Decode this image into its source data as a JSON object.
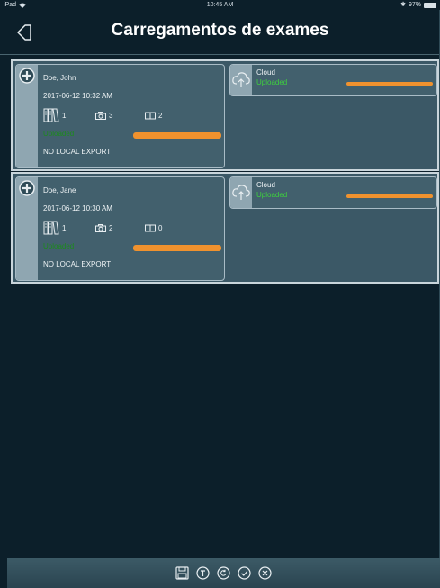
{
  "status_bar": {
    "device": "iPad",
    "time": "10:45 AM",
    "battery": "97%"
  },
  "header": {
    "title": "Carregamentos de exames",
    "back_icon": "back-arrow-icon"
  },
  "exams": [
    {
      "name": "Doe, John",
      "date": "2017-06-12 10:32 AM",
      "series_count": "1",
      "photo_count": "3",
      "report_count": "2",
      "status": "Uploaded",
      "progress": 1.0,
      "export": "NO LOCAL EXPORT",
      "cloud": {
        "label": "Cloud",
        "status": "Uploaded",
        "progress": 1.0
      }
    },
    {
      "name": "Doe, Jane",
      "date": "2017-06-12 10:30 AM",
      "series_count": "1",
      "photo_count": "2",
      "report_count": "0",
      "status": "Uploaded",
      "progress": 1.0,
      "export": "NO LOCAL EXPORT",
      "cloud": {
        "label": "Cloud",
        "status": "Uploaded",
        "progress": 1.0
      }
    }
  ],
  "toolbar": {
    "buttons": [
      "save-icon",
      "text-icon",
      "retry-icon",
      "check-icon",
      "close-icon"
    ]
  },
  "colors": {
    "background": "#0c1f2a",
    "row": "#3b5866",
    "progress": "#f0922e",
    "status_dark_green": "#1c8a1c",
    "status_bright_green": "#3ed13e"
  }
}
